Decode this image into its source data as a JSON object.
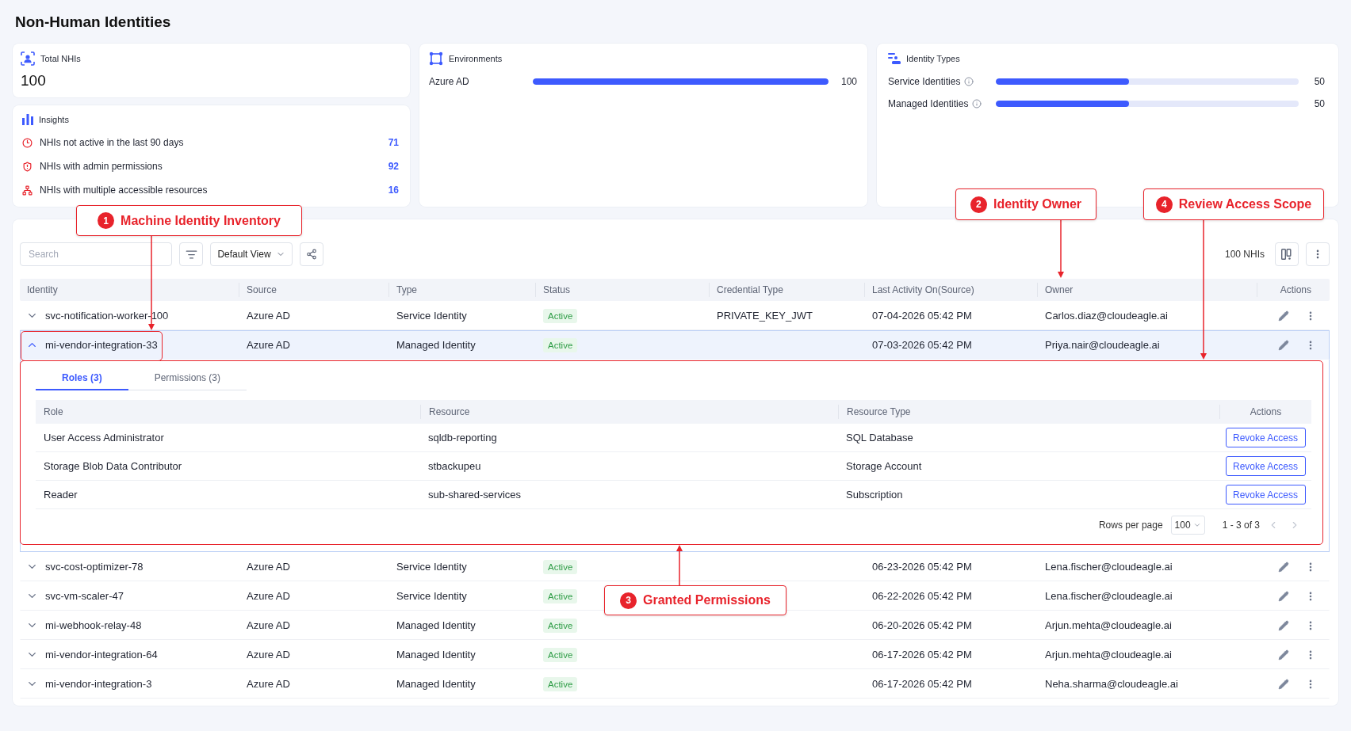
{
  "page": {
    "title": "Non-Human Identities"
  },
  "total_nhis": {
    "label": "Total NHIs",
    "value": "100"
  },
  "insights": {
    "title": "Insights",
    "items": [
      {
        "kind": "inactive",
        "label": "NHIs not active in the last 90 days",
        "count": "71"
      },
      {
        "kind": "admin",
        "label": "NHIs with admin permissions",
        "count": "92"
      },
      {
        "kind": "resources",
        "label": "NHIs with multiple accessible resources",
        "count": "16"
      }
    ]
  },
  "environments": {
    "title": "Environments",
    "items": [
      {
        "label": "Azure AD",
        "level": 1,
        "count": "100"
      }
    ]
  },
  "identity_types": {
    "title": "Identity Types",
    "items": [
      {
        "label": "Service Identities",
        "level": 0.44,
        "count": "50"
      },
      {
        "label": "Managed Identities",
        "level": 0.44,
        "count": "50"
      }
    ]
  },
  "toolbar": {
    "search": {
      "placeholder": "Search"
    },
    "view": "Default View",
    "count": "100 NHIs"
  },
  "table": {
    "columns": [
      "Identity",
      "Source",
      "Type",
      "Status",
      "Credential Type",
      "Last Activity On(Source)",
      "Owner",
      "Actions"
    ],
    "rows": [
      {
        "identity": "svc-notification-worker-100",
        "source": "Azure AD",
        "type": "Service Identity",
        "status": "Active",
        "credential_type": "PRIVATE_KEY_JWT",
        "last_activity": "07-04-2026 05:42 PM",
        "owner": "Carlos.diaz@cloudeagle.ai",
        "expanded": false
      },
      {
        "identity": "mi-vendor-integration-33",
        "source": "Azure AD",
        "type": "Managed Identity",
        "status": "Active",
        "last_activity": "07-03-2026 05:42 PM",
        "owner": "Priya.nair@cloudeagle.ai",
        "expanded": true,
        "details": {
          "tabs": [
            {
              "label": "Roles (3)",
              "selected": true
            },
            {
              "label": "Permissions (3)",
              "selected": false
            }
          ],
          "columns": [
            "Role",
            "Resource",
            "Resource Type",
            "Actions"
          ],
          "rows": [
            {
              "role": "User Access Administrator",
              "resource": "sqldb-reporting",
              "resource_type": "SQL Database",
              "action": "Revoke Access"
            },
            {
              "role": "Storage Blob Data Contributor",
              "resource": "stbackupeu",
              "resource_type": "Storage Account",
              "action": "Revoke Access"
            },
            {
              "role": "Reader",
              "resource": "sub-shared-services",
              "resource_type": "Subscription",
              "action": "Revoke Access"
            }
          ],
          "pagination": {
            "rows_per_page_label": "Rows per page",
            "rows_per_page": "100",
            "range": "1 - 3 of 3"
          }
        }
      },
      {
        "identity": "svc-cost-optimizer-78",
        "source": "Azure AD",
        "type": "Service Identity",
        "status": "Active",
        "last_activity": "06-23-2026 05:42 PM",
        "owner": "Lena.fischer@cloudeagle.ai",
        "expanded": false
      },
      {
        "identity": "svc-vm-scaler-47",
        "source": "Azure AD",
        "type": "Service Identity",
        "status": "Active",
        "last_activity": "06-22-2026 05:42 PM",
        "owner": "Lena.fischer@cloudeagle.ai",
        "expanded": false
      },
      {
        "identity": "mi-webhook-relay-48",
        "source": "Azure AD",
        "type": "Managed Identity",
        "status": "Active",
        "last_activity": "06-20-2026 05:42 PM",
        "owner": "Arjun.mehta@cloudeagle.ai",
        "expanded": false
      },
      {
        "identity": "mi-vendor-integration-64",
        "source": "Azure AD",
        "type": "Managed Identity",
        "status": "Active",
        "last_activity": "06-17-2026 05:42 PM",
        "owner": "Arjun.mehta@cloudeagle.ai",
        "expanded": false
      },
      {
        "identity": "mi-vendor-integration-3",
        "source": "Azure AD",
        "type": "Managed Identity",
        "status": "Active",
        "last_activity": "06-17-2026 05:42 PM",
        "owner": "Neha.sharma@cloudeagle.ai",
        "expanded": false
      }
    ]
  },
  "annotations": [
    {
      "number": "1",
      "label": "Machine Identity Inventory"
    },
    {
      "number": "2",
      "label": "Identity Owner"
    },
    {
      "number": "3",
      "label": "Granted Permissions"
    },
    {
      "number": "4",
      "label": "Review Access Scope"
    }
  ]
}
